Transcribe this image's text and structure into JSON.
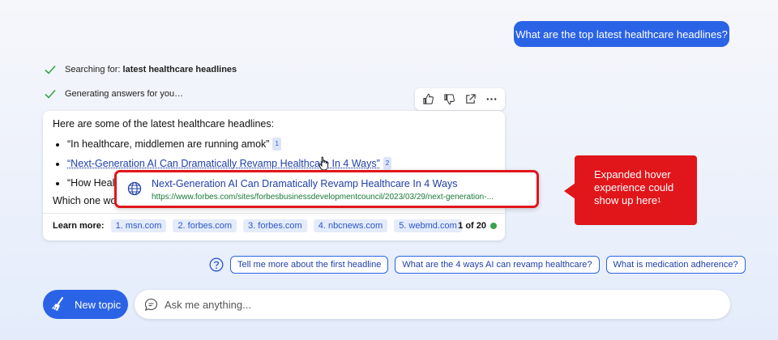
{
  "user_message": "What are the top latest healthcare headlines?",
  "status": {
    "searching_label": "Searching for: ",
    "searching_query": "latest healthcare headlines",
    "generating": "Generating answers for you…"
  },
  "answer": {
    "intro": "Here are some of the latest healthcare headlines:",
    "items": [
      {
        "text": "“In healthcare, middlemen are running amok”",
        "ref": "1"
      },
      {
        "text": "“Next-Generation AI Can Dramatically Revamp Healthcare In 4 Ways”",
        "ref": "2"
      },
      {
        "text": "“How Heal",
        "ref": ""
      }
    ],
    "which": "Which one wo",
    "learn_more_label": "Learn more:",
    "sources": [
      "1. msn.com",
      "2. forbes.com",
      "3. forbes.com",
      "4. nbcnews.com",
      "5. webmd.com"
    ],
    "pager": "1 of 20",
    "pager_color": "#3aa24a"
  },
  "hover_card": {
    "title": "Next-Generation AI Can Dramatically Revamp Healthcare In 4 Ways",
    "url": "https://www.forbes.com/sites/forbesbusinessdevelopmentcouncil/2023/03/29/next-generation-..."
  },
  "callout": {
    "text": "Expanded hover experience could show up here",
    "footnote": "1",
    "color": "#e0161b"
  },
  "suggestions": [
    "Tell me more about the first headline",
    "What are the 4 ways AI can revamp healthcare?",
    "What is medication adherence?"
  ],
  "new_topic_label": "New topic",
  "ask_placeholder": "Ask me anything...",
  "accent": "#2b63e6"
}
